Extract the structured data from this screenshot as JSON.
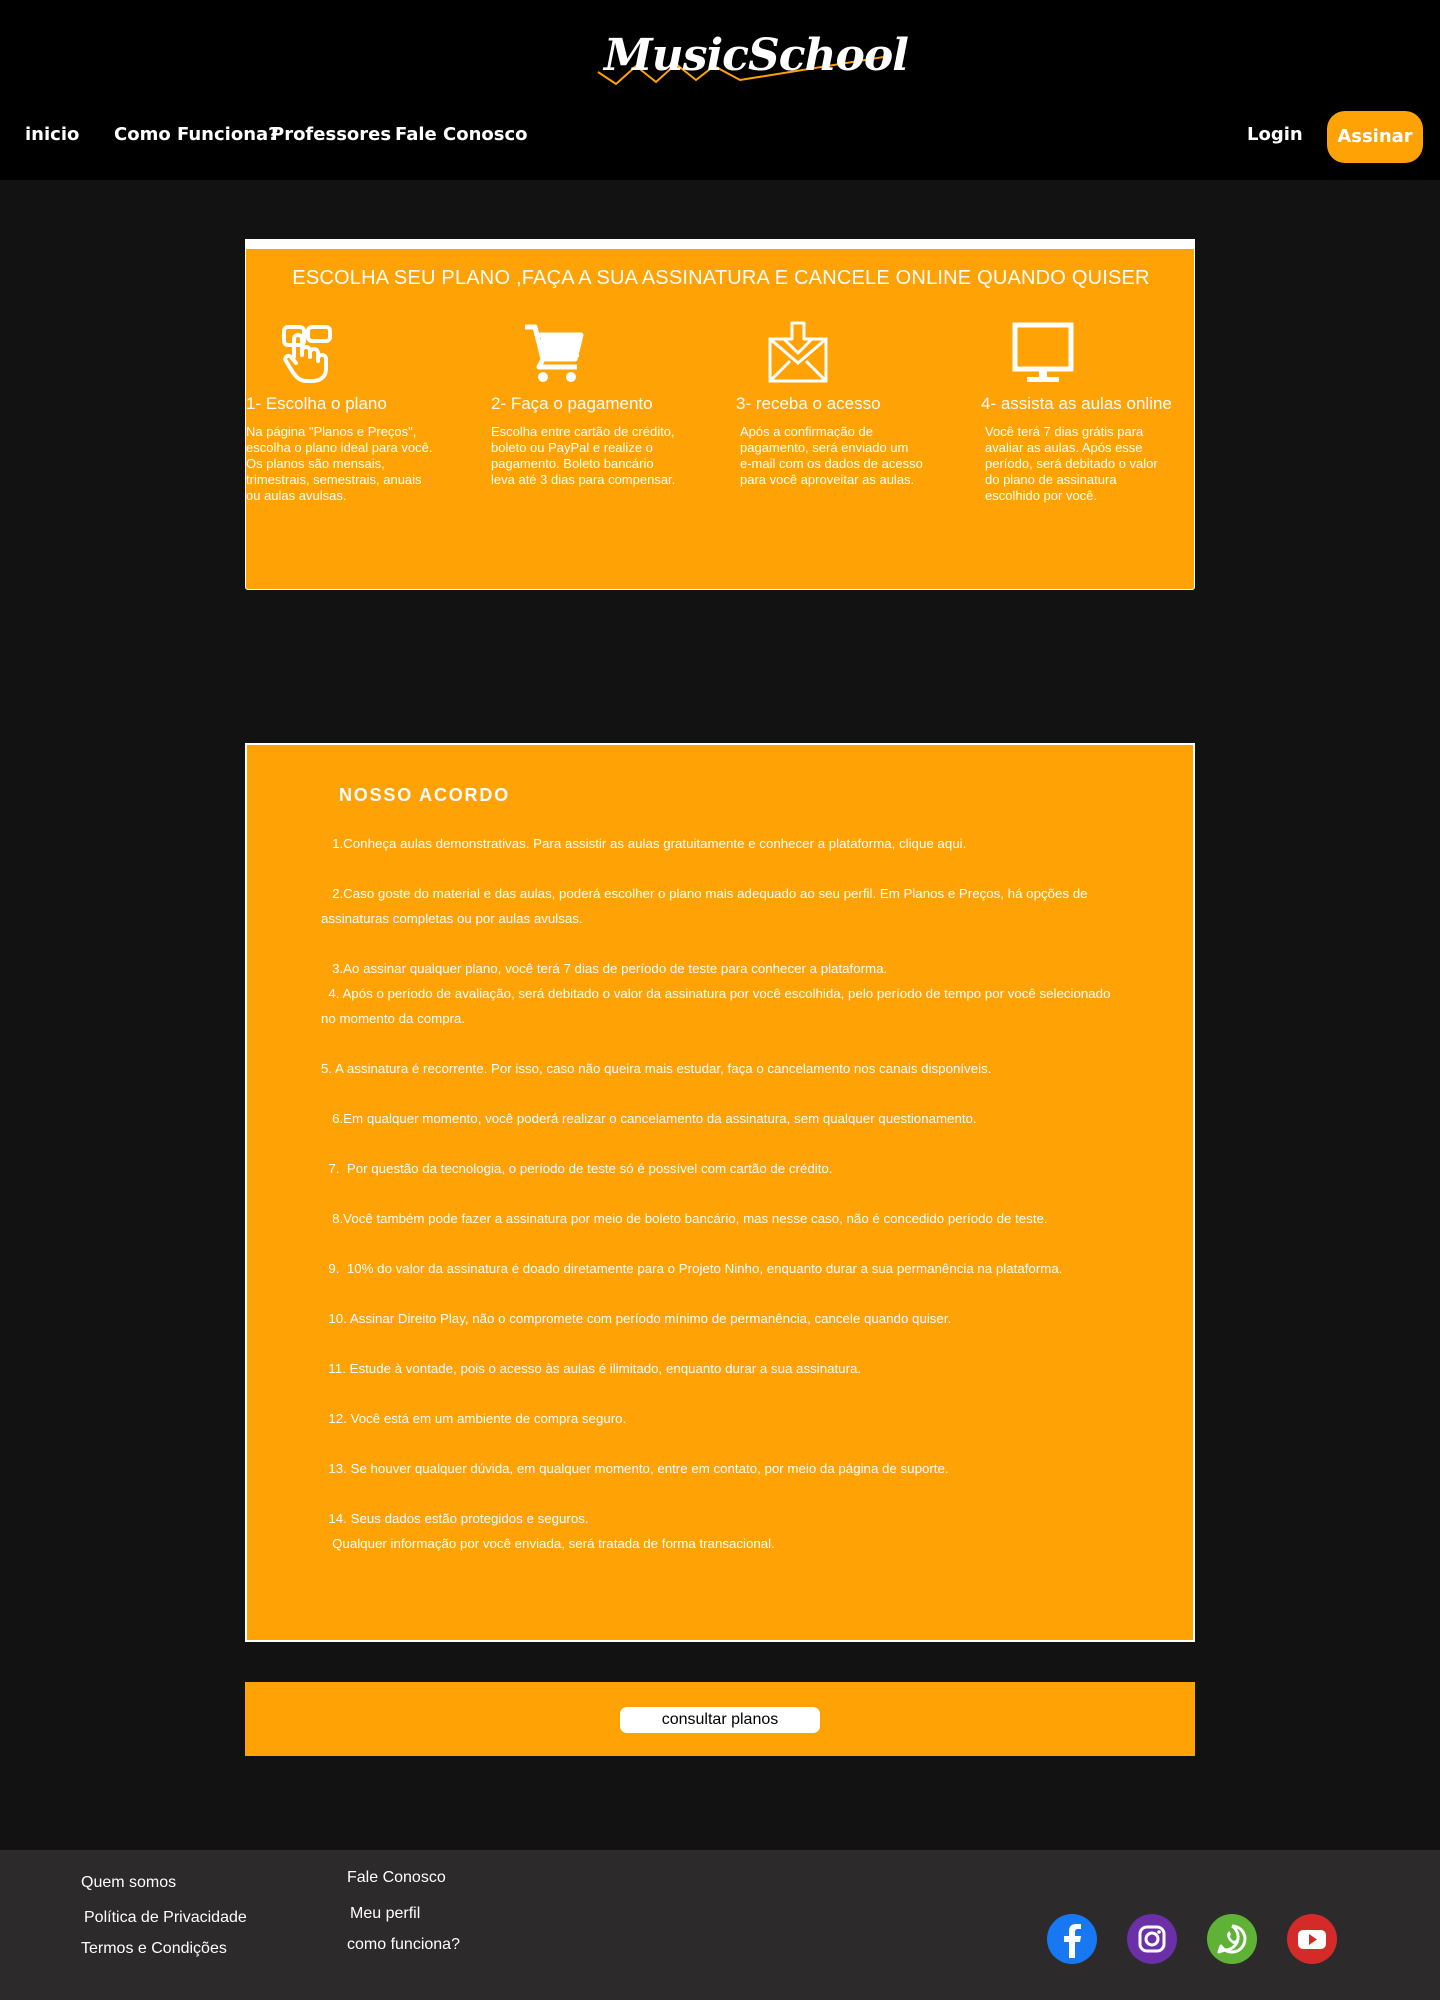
{
  "header": {
    "logo_text": "MusicSchool",
    "nav": [
      "inicio",
      "Como Funciona?",
      "Professores",
      "Fale Conosco"
    ],
    "login": "Login",
    "subscribe": "Assinar"
  },
  "steps": {
    "title": "ESCOLHA SEU PLANO ,FAÇA A SUA  ASSINATURA E CANCELE ONLINE QUANDO QUISER",
    "items": [
      {
        "icon": "touch-icon",
        "title": "1- Escolha o plano",
        "desc": "Na página \"Planos e Preços\",\nescolha o plano ideal para você.\nOs planos são mensais,\ntrimestrais, semestrais, anuais\nou aulas avulsas."
      },
      {
        "icon": "cart-icon",
        "title": "2- Faça o pagamento",
        "desc": "Escolha entre cartão de crédito,\nboleto ou PayPal e realize o\npagamento. Boleto bancário\nleva até 3 dias para compensar."
      },
      {
        "icon": "mail-icon",
        "title": "3- receba o acesso",
        "desc": "Após a confirmação de\npagamento, será enviado um\ne-mail com os dados de acesso\npara você aproveitar as aulas."
      },
      {
        "icon": "monitor-icon",
        "title": "4- assista as aulas online",
        "desc": "Você terá 7 dias grátis para\navaliar as aulas. Após esse\nperíodo, será debitado o valor\ndo plano de assinatura\nescolhido por você."
      }
    ]
  },
  "acordo": {
    "title": "NOSSO ACORDO",
    "items": [
      "   1.Conheça aulas demonstrativas. Para assistir as aulas gratuitamente e conhecer a plataforma, clique aqui.",
      "",
      "   2.Caso goste do material e das aulas, poderá escolher o plano mais adequado ao seu perfil. Em Planos e Preços, há opções de assinaturas completas ou por aulas avulsas.",
      "",
      "   3.Ao assinar qualquer plano, você terá 7 dias de período de teste para conhecer a plataforma.",
      "  4. Após o período de avaliação, será debitado o valor da assinatura por você escolhida, pelo período de tempo por você selecionado no momento da compra.",
      "",
      "5. A assinatura é recorrente. Por isso, caso não queira mais estudar, faça o cancelamento nos canais disponíveis.",
      "",
      "   6.Em qualquer momento, você poderá realizar o cancelamento da assinatura, sem qualquer questionamento.",
      "",
      "  7.  Por questão da tecnologia, o período de teste só é possível com cartão de crédito.",
      "",
      "   8.Você também pode fazer a assinatura por meio de boleto bancário, mas nesse caso, não é concedido período de teste.",
      "",
      "  9.  10% do valor da assinatura é doado diretamente para o Projeto Ninho, enquanto durar a sua permanência na plataforma.",
      "",
      "  10. Assinar Direito Play, não o compromete com período mínimo de permanência, cancele quando quiser.",
      "",
      "  11. Estude à vontade, pois o acesso às aulas é ilimitado, enquanto durar a sua assinatura.",
      "",
      "  12. Você está em um ambiente de compra seguro.",
      "",
      "  13. Se houver qualquer dúvida, em qualquer momento, entre em contato, por meio da página de suporte.",
      "",
      "  14. Seus dados estão protegidos e seguros.",
      "   Qualquer informação por você enviada, será tratada de forma transacional."
    ]
  },
  "cta": {
    "label": "consultar planos"
  },
  "footer": {
    "col1": [
      "Quem somos",
      "Política de Privacidade",
      "Termos e Condições"
    ],
    "col2": [
      "Fale Conosco",
      "Meu perfil",
      "como funciona?"
    ],
    "social": [
      "facebook-icon",
      "instagram-icon",
      "whatsapp-icon",
      "youtube-icon"
    ]
  },
  "colors": {
    "accent": "#ffa205",
    "header_bg": "#000000",
    "page_bg": "#121212",
    "footer_bg": "#2c2a2a"
  }
}
